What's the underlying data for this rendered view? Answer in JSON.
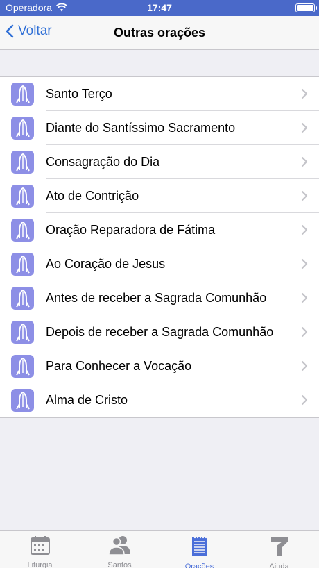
{
  "status_bar": {
    "carrier": "Operadora",
    "time": "17:47"
  },
  "navbar": {
    "back_label": "Voltar",
    "title": "Outras orações"
  },
  "prayers": [
    {
      "label": "Santo Terço"
    },
    {
      "label": "Diante do Santíssimo Sacramento"
    },
    {
      "label": "Consagração do Dia"
    },
    {
      "label": "Ato de Contrição"
    },
    {
      "label": "Oração Reparadora de Fátima"
    },
    {
      "label": "Ao Coração de Jesus"
    },
    {
      "label": "Antes de receber a Sagrada Comunhão"
    },
    {
      "label": "Depois de receber a Sagrada Comunhão"
    },
    {
      "label": "Para Conhecer a Vocação"
    },
    {
      "label": "Alma de Cristo"
    }
  ],
  "tabbar": {
    "tabs": [
      {
        "label": "Liturgia",
        "icon": "calendar-icon",
        "active": false
      },
      {
        "label": "Santos",
        "icon": "people-icon",
        "active": false
      },
      {
        "label": "Orações",
        "icon": "notepad-icon",
        "active": true
      },
      {
        "label": "Ajuda",
        "icon": "help-icon",
        "active": false
      }
    ]
  },
  "colors": {
    "status_bar": "#4a69c9",
    "accent": "#2f6fd6",
    "row_icon_bg": "#8d8fe6",
    "active_tab": "#4b6fd9",
    "inactive_tab": "#8e8e93"
  }
}
